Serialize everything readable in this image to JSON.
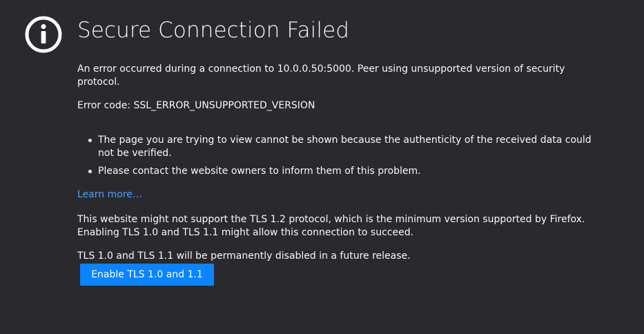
{
  "error_page": {
    "icon": "info-icon",
    "title": "Secure Connection Failed",
    "description": "An error occurred during a connection to 10.0.0.50:5000. Peer using unsupported version of security protocol.",
    "error_code": "Error code: SSL_ERROR_UNSUPPORTED_VERSION",
    "reasons": [
      "The page you are trying to view cannot be shown because the authenticity of the received data could not be verified.",
      "Please contact the website owners to inform them of this problem."
    ],
    "learn_more_label": "Learn more…",
    "tls_info": "This website might not support the TLS 1.2 protocol, which is the minimum version supported by Firefox. Enabling TLS 1.0 and TLS 1.1 might allow this connection to succeed.",
    "tls_note": "TLS 1.0 and TLS 1.1 will be permanently disabled in a future release.",
    "enable_button_label": "Enable TLS 1.0 and 1.1"
  },
  "colors": {
    "background": "#2a2a2e",
    "text": "#f9f9fa",
    "link": "#45a1ff",
    "button": "#0a84ff"
  }
}
